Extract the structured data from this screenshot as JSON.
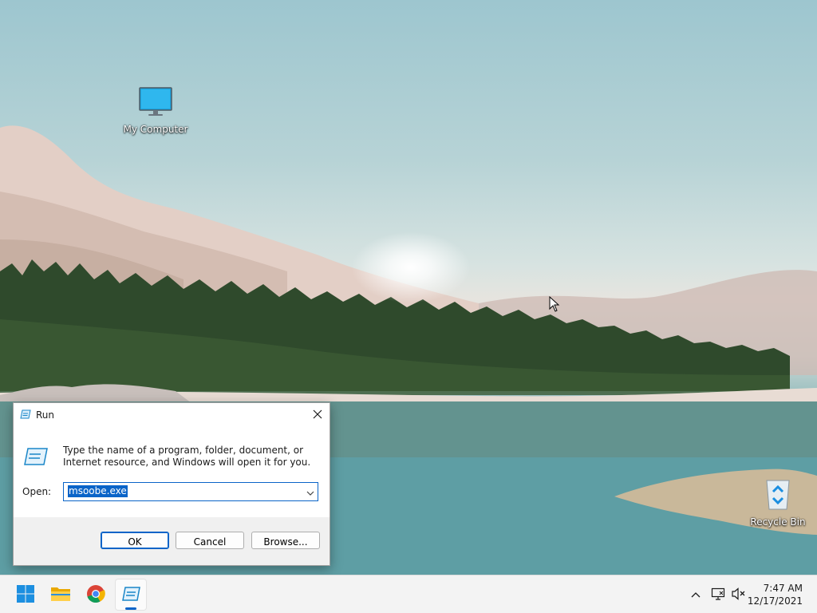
{
  "desktop": {
    "icons": [
      {
        "label": "My Computer",
        "icon": "monitor-icon"
      },
      {
        "label": "Recycle Bin",
        "icon": "recycle-bin-icon"
      }
    ]
  },
  "run_dialog": {
    "title": "Run",
    "description": "Type the name of a program, folder, document, or Internet resource, and Windows will open it for you.",
    "open_label": "Open:",
    "open_value": "msoobe.exe",
    "ok_label": "OK",
    "cancel_label": "Cancel",
    "browse_label": "Browse..."
  },
  "taskbar": {
    "items": [
      {
        "name": "start",
        "icon": "windows-logo-icon"
      },
      {
        "name": "file-explorer",
        "icon": "folder-icon"
      },
      {
        "name": "chrome",
        "icon": "chrome-icon"
      },
      {
        "name": "run",
        "icon": "run-icon",
        "active": true
      }
    ],
    "tray": {
      "icons": [
        "chevron-up-icon",
        "network-icon",
        "volume-muted-icon"
      ]
    },
    "clock": {
      "time": "7:47 AM",
      "date": "12/17/2021"
    }
  },
  "colors": {
    "accent": "#0a64c8",
    "taskbar_bg": "#f3f3f3"
  }
}
